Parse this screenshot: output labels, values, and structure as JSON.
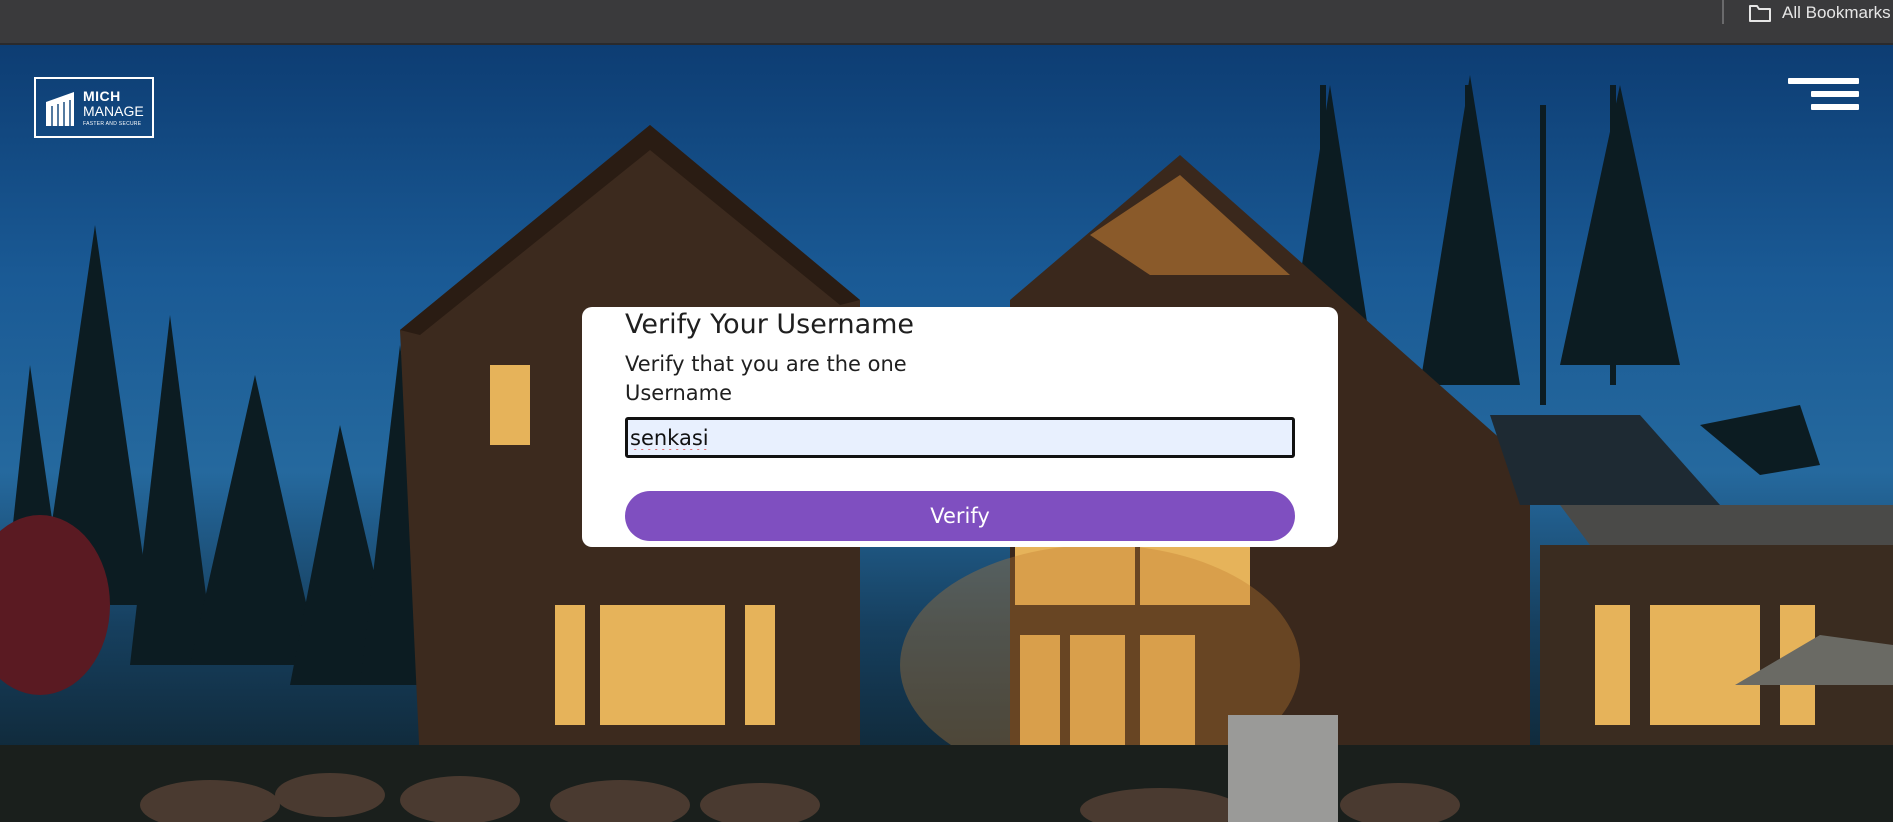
{
  "browser": {
    "bookmarks_label": "All Bookmarks",
    "bookmarks_icon": "folder-icon"
  },
  "header": {
    "logo": {
      "line1": "MICH",
      "line2": "MANAGE",
      "tagline": "FASTER AND SECURE"
    },
    "menu_icon": "hamburger-menu-icon"
  },
  "card": {
    "title": "Verify Your Username",
    "subtitle": "Verify that you are the one",
    "field_label": "Username",
    "username_value": "senkasi",
    "verify_label": "Verify"
  },
  "colors": {
    "button": "#7f4fc0",
    "input_bg": "#e8f0fe",
    "topbar": "#3a3a3c"
  }
}
